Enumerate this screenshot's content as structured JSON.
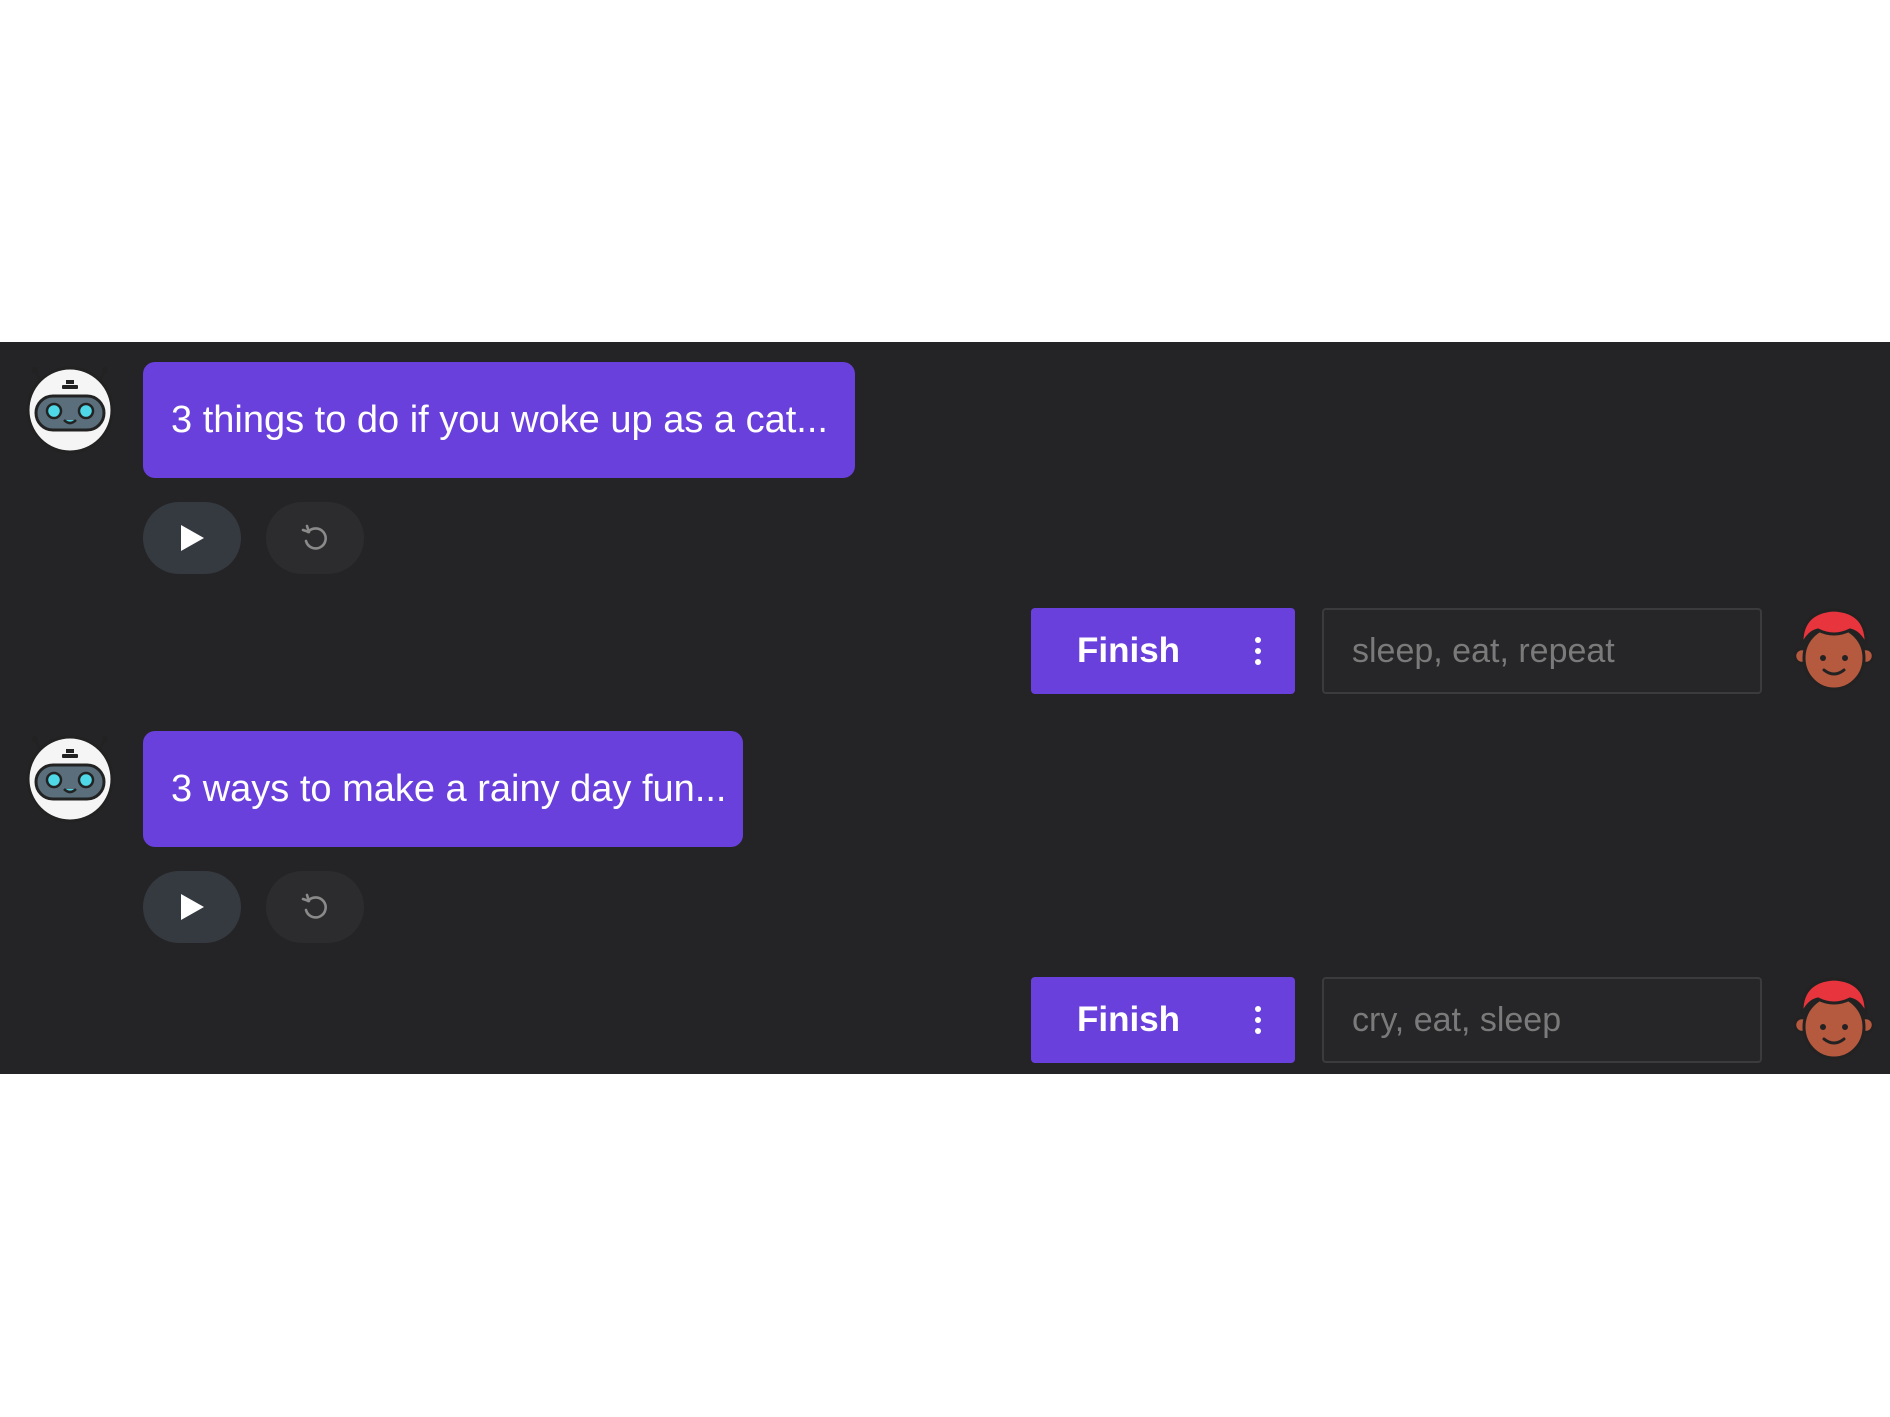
{
  "conversation": {
    "turns": [
      {
        "prompt": "3 things to do if you woke up as a cat...",
        "play_icon": "play-icon",
        "retry_icon": "retry-icon",
        "finish_label": "Finish",
        "menu_icon": "more-vertical-icon",
        "answer_placeholder": "sleep, eat, repeat"
      },
      {
        "prompt": "3 ways to make a rainy day fun...",
        "play_icon": "play-icon",
        "retry_icon": "retry-icon",
        "finish_label": "Finish",
        "menu_icon": "more-vertical-icon",
        "answer_placeholder": "cry, eat, sleep"
      }
    ]
  },
  "colors": {
    "panel_background": "#242426",
    "accent": "#6a40dc",
    "page_background": "#ffffff"
  }
}
